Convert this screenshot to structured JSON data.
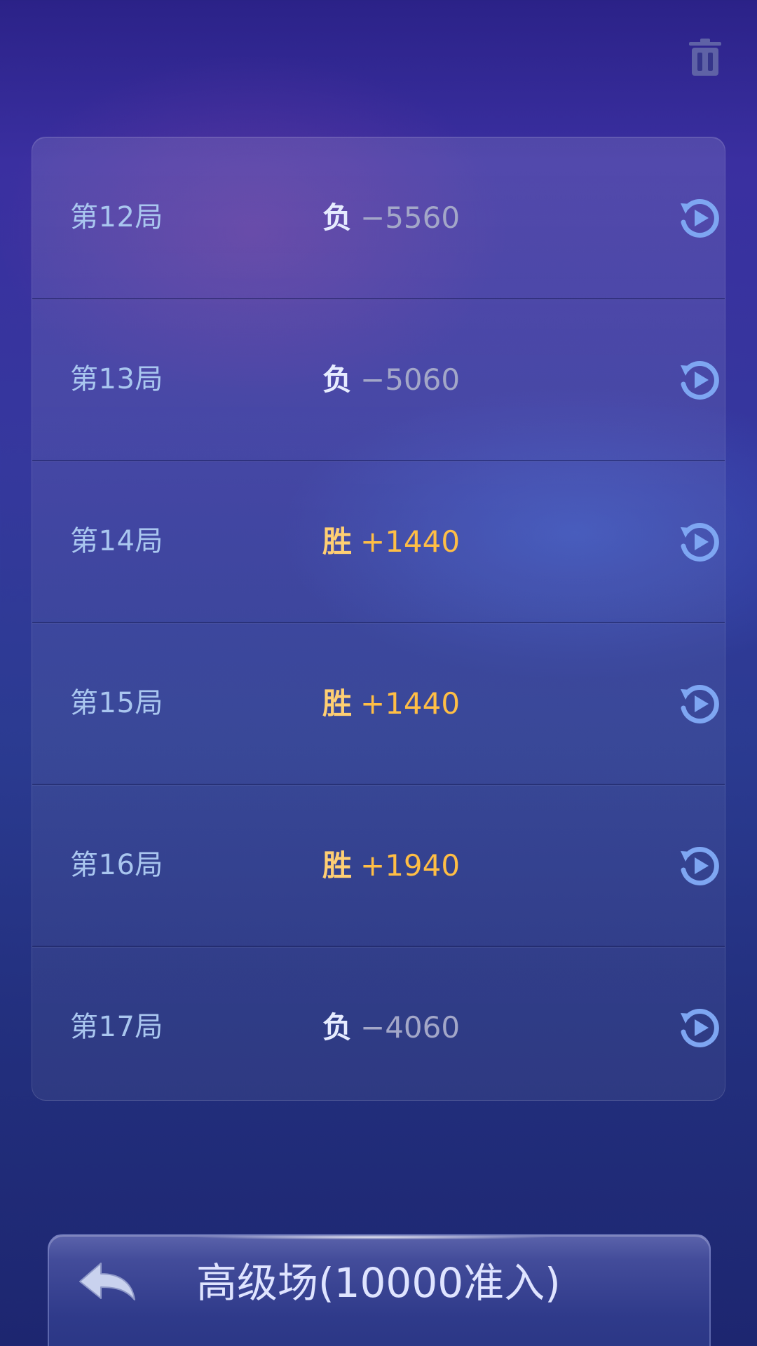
{
  "toolbar": {
    "delete_icon": "trash-icon"
  },
  "history": [
    {
      "round": "第12局",
      "outcome": "负",
      "score": "−5560",
      "result": "lose",
      "replay_icon": "replay-icon"
    },
    {
      "round": "第13局",
      "outcome": "负",
      "score": "−5060",
      "result": "lose",
      "replay_icon": "replay-icon"
    },
    {
      "round": "第14局",
      "outcome": "胜",
      "score": "+1440",
      "result": "win",
      "replay_icon": "replay-icon"
    },
    {
      "round": "第15局",
      "outcome": "胜",
      "score": "+1440",
      "result": "win",
      "replay_icon": "replay-icon"
    },
    {
      "round": "第16局",
      "outcome": "胜",
      "score": "+1940",
      "result": "win",
      "replay_icon": "replay-icon"
    },
    {
      "round": "第17局",
      "outcome": "负",
      "score": "−4060",
      "result": "lose",
      "replay_icon": "replay-icon"
    }
  ],
  "footer": {
    "back_icon": "back-arrow-icon",
    "room_label": "高级场(10000准入)"
  },
  "colors": {
    "win": "#ffbe45",
    "lose": "#a3a7c8",
    "round_label": "#a9c6ef",
    "icon_blue": "#7ea6f2"
  }
}
